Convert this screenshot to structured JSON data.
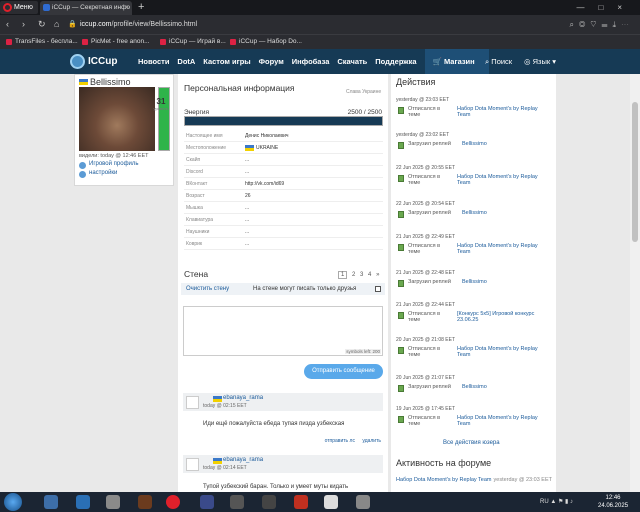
{
  "browser": {
    "menu_label": "Меню",
    "tab_title": "iCCup — Секретная инфо",
    "new_tab_glyph": "+",
    "url_domain": "iccup.com",
    "url_path": "/profile/view/Bellissimo.html",
    "bookmarks": [
      "TransFiles - беспла...",
      "PicMet - free anon...",
      "iCCup — Играй в...",
      "iCCup — Набор Do..."
    ]
  },
  "site": {
    "logo": "ICCup",
    "nav": [
      "Новости",
      "DotA",
      "Кастом игры",
      "Форум",
      "Инфобаза",
      "Скачать",
      "Поддержка"
    ],
    "shop": "Магазин",
    "search": "Поиск",
    "lang": "Язык"
  },
  "profile": {
    "username": "Bellissimo",
    "visited": "видели: today @ 12:46 EET",
    "link_game_profile": "Игровой профиль",
    "link_settings": "настройки",
    "level": "31",
    "level_label": "уровень",
    "energy_fill": 1.0
  },
  "personal": {
    "title": "Персональная информация",
    "glory": "Слава Украине",
    "energy_label": "Энергия",
    "energy_value": "2500 / 2500",
    "energy_fill": 1.0,
    "fields": [
      {
        "k": "Настоящее имя",
        "v": "Денис Николаевич"
      },
      {
        "k": "Местоположение",
        "v": "UKRAINE"
      },
      {
        "k": "Скайп",
        "v": "..."
      },
      {
        "k": "Discord",
        "v": "..."
      },
      {
        "k": "ВКонтакт",
        "v": "http://vk.com/id69"
      },
      {
        "k": "Возраст",
        "v": "26"
      },
      {
        "k": "Мышка",
        "v": "..."
      },
      {
        "k": "Клавиатура",
        "v": "..."
      },
      {
        "k": "Наушники",
        "v": "..."
      },
      {
        "k": "Коврик",
        "v": "..."
      }
    ]
  },
  "wall": {
    "title": "Стена",
    "pages": [
      "1",
      "2",
      "3",
      "4",
      "»"
    ],
    "clear": "Очистить стену",
    "friends_only": "На стене могут писать только друзья",
    "symbols_left": "symbols left: 200",
    "send": "Отправить сообщение",
    "posts": [
      {
        "author": "ebanaya_rama",
        "time": "today @ 02:15 EET",
        "text": "Иди ещё пожалуйста ебеда тупая пизда узбекская",
        "reply": "отправить лс",
        "delete": "удалить"
      },
      {
        "author": "ebanaya_rama",
        "time": "today @ 02:14 EET",
        "text": "Тупой узбекский баран. Только и умеет муты кидать",
        "reply": "",
        "delete": ""
      }
    ]
  },
  "actions": {
    "title": "Действия",
    "items": [
      {
        "date": "yesterday @ 23:03 EET",
        "label": "Отписался в теме",
        "link": "Набор Dota Moment's by Replay Team"
      },
      {
        "date": "yesterday @ 23:02 EET",
        "label": "Загрузил реплей",
        "link": "Bellissimo"
      },
      {
        "date": "22 Jun 2025 @ 20:55 EET",
        "label": "Отписался в теме",
        "link": "Набор Dota Moment's by Replay Team"
      },
      {
        "date": "22 Jun 2025 @ 20:54 EET",
        "label": "Загрузил реплей",
        "link": "Bellissimo"
      },
      {
        "date": "21 Jun 2025 @ 22:49 EET",
        "label": "Отписался в теме",
        "link": "Набор Dota Moment's by Replay Team"
      },
      {
        "date": "21 Jun 2025 @ 22:48 EET",
        "label": "Загрузил реплей",
        "link": "Bellissimo"
      },
      {
        "date": "21 Jun 2025 @ 22:44 EET",
        "label": "Отписался в теме",
        "link": "[Конкурс 5х5] Игровой конкурс 23.06.25"
      },
      {
        "date": "20 Jun 2025 @ 21:08 EET",
        "label": "Отписался в теме",
        "link": "Набор Dota Moment's by Replay Team"
      },
      {
        "date": "20 Jun 2025 @ 21:07 EET",
        "label": "Загрузил реплей",
        "link": "Bellissimo"
      },
      {
        "date": "19 Jun 2025 @ 17:45 EET",
        "label": "Отписался в теме",
        "link": "Набор Dota Moment's by Replay Team"
      }
    ],
    "all": "Все действия юзера"
  },
  "forum": {
    "title": "Активность на форуме",
    "row_link": "Набор Dota Moment's by Replay Team",
    "row_time": "yesterday @ 23:03 EET"
  },
  "taskbar": {
    "lang": "RU",
    "time": "12:46",
    "date": "24.06.2025"
  },
  "colors": {
    "header": "#163a55",
    "accent": "#5aa9ea",
    "link": "#1a5a9a",
    "energy": "#2fb44a"
  }
}
